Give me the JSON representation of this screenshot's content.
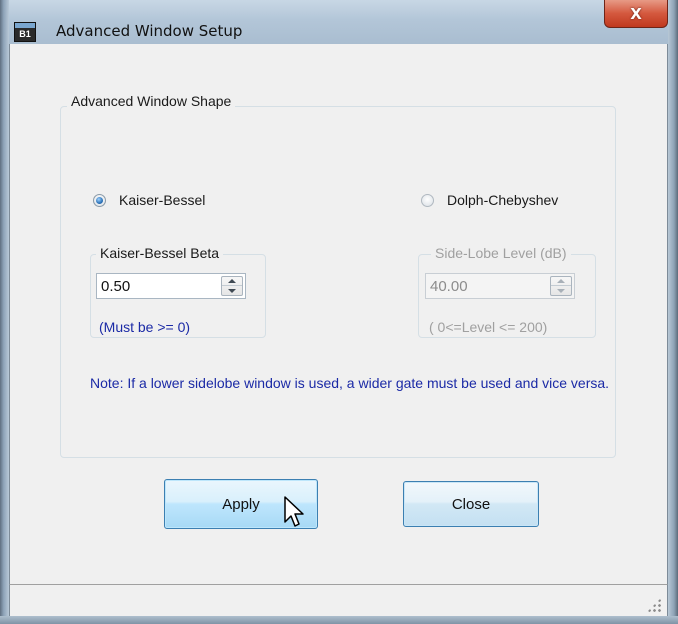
{
  "window": {
    "title": "Advanced Window Setup",
    "icon_glyph": "B1",
    "close_glyph": "X"
  },
  "group": {
    "label": "Advanced Window Shape"
  },
  "options": {
    "kaiser": {
      "label": "Kaiser-Bessel",
      "selected": true
    },
    "dolph": {
      "label": "Dolph-Chebyshev",
      "selected": false
    }
  },
  "kaiser_beta": {
    "label": "Kaiser-Bessel Beta",
    "value": "0.50",
    "hint": "(Must be >= 0)"
  },
  "sidelobe": {
    "label": "Side-Lobe Level (dB)",
    "value": "40.00",
    "hint": "( 0<=Level <= 200)",
    "enabled": false
  },
  "note": "Note: If a lower sidelobe window is used, a wider gate must be used and vice versa.",
  "buttons": {
    "apply": "Apply",
    "close": "Close"
  },
  "colors": {
    "hint_text": "#1b2aa6",
    "disabled_text": "#a0a0a0",
    "titlebar": "#b3c6d8",
    "close_button": "#d4583e"
  }
}
